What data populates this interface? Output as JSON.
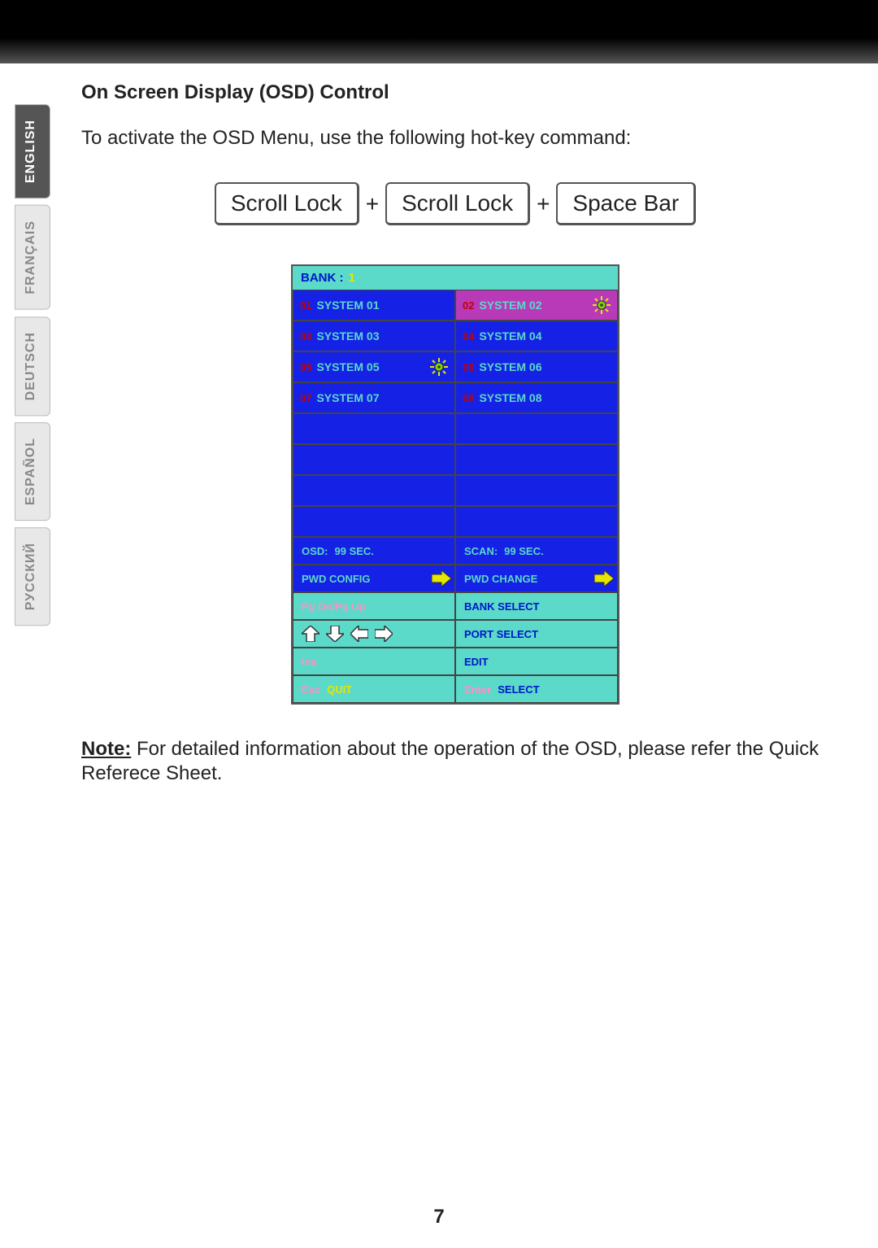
{
  "page_number": "7",
  "sidebar": {
    "tabs": [
      {
        "label": "ENGLISH",
        "active": true
      },
      {
        "label": "FRANÇAIS",
        "active": false
      },
      {
        "label": "DEUTSCH",
        "active": false
      },
      {
        "label": "ESPAÑOL",
        "active": false
      },
      {
        "label": "РУССКИЙ",
        "active": false
      }
    ]
  },
  "section": {
    "title": "On Screen Display (OSD) Control",
    "intro": "To activate the OSD Menu, use the following hot-key command:"
  },
  "keys": {
    "k1": "Scroll Lock",
    "k2": "Scroll Lock",
    "k3": "Space Bar",
    "plus": "+"
  },
  "osd": {
    "bank_label": "BANK :",
    "bank_num": "1",
    "systems": [
      {
        "num": "01",
        "name": "SYSTEM 01",
        "sun": false,
        "selected": false
      },
      {
        "num": "02",
        "name": "SYSTEM 02",
        "sun": true,
        "selected": true
      },
      {
        "num": "03",
        "name": "SYSTEM 03",
        "sun": false,
        "selected": false
      },
      {
        "num": "04",
        "name": "SYSTEM 04",
        "sun": false,
        "selected": false
      },
      {
        "num": "05",
        "name": "SYSTEM 05",
        "sun": true,
        "selected": false
      },
      {
        "num": "06",
        "name": "SYSTEM 06",
        "sun": false,
        "selected": false
      },
      {
        "num": "07",
        "name": "SYSTEM 07",
        "sun": false,
        "selected": false
      },
      {
        "num": "08",
        "name": "SYSTEM 08",
        "sun": false,
        "selected": false
      }
    ],
    "osd_label": "OSD:",
    "osd_val": "99 SEC.",
    "scan_label": "SCAN:",
    "scan_val": "99 SEC.",
    "pwd_config": "PWD CONFIG",
    "pwd_change": "PWD CHANGE",
    "pgdnup": "Pg Dn/Pg Up",
    "bank_select": "BANK SELECT",
    "port_select": "PORT SELECT",
    "ins": "Ins",
    "edit": "EDIT",
    "esc": "Esc",
    "quit": "QUIT",
    "enter": "Enter",
    "select": "SELECT"
  },
  "note": {
    "label": "Note:",
    "text": " For detailed information about the operation of the OSD, please refer the Quick Referece Sheet."
  }
}
